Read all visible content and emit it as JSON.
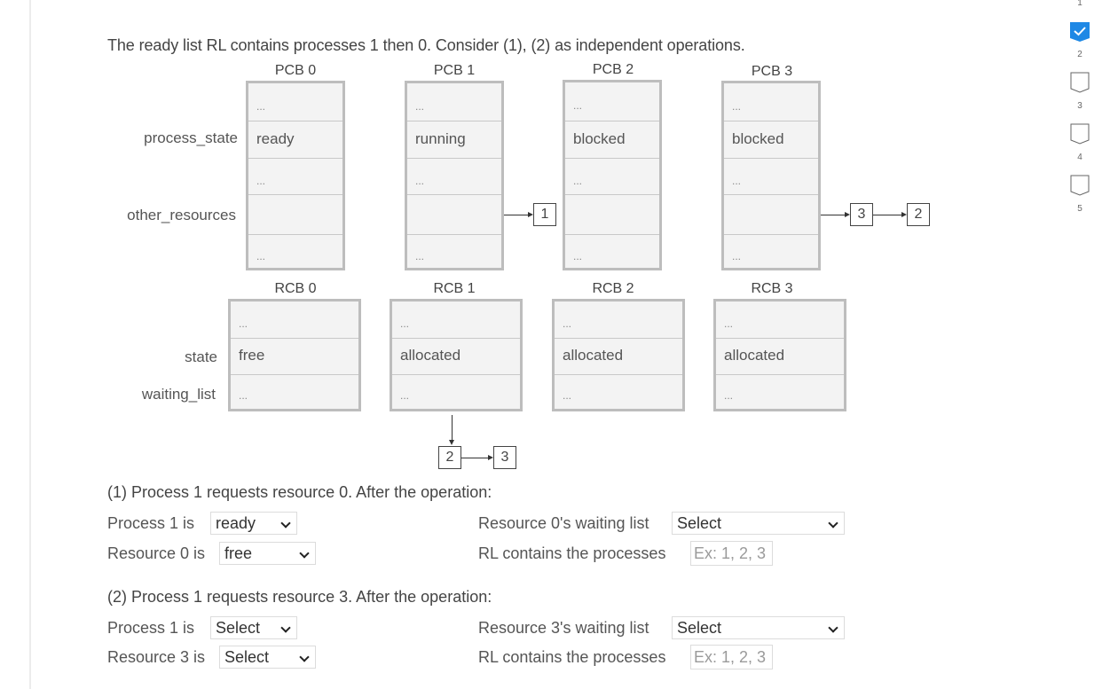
{
  "intro": "The ready list RL contains processes 1 then 0. Consider (1), (2) as independent operations.",
  "pcb_row_labels": {
    "process_state": "process_state",
    "other_resources": "other_resources"
  },
  "pcbs": [
    {
      "title": "PCB 0",
      "cells": [
        "...",
        "ready",
        "...",
        "",
        "..."
      ],
      "other_resources_list": []
    },
    {
      "title": "PCB 1",
      "cells": [
        "...",
        "running",
        "...",
        "",
        "..."
      ],
      "other_resources_list": [
        "1"
      ]
    },
    {
      "title": "PCB 2",
      "cells": [
        "...",
        "blocked",
        "...",
        "",
        "..."
      ],
      "other_resources_list": []
    },
    {
      "title": "PCB 3",
      "cells": [
        "...",
        "blocked",
        "...",
        "",
        "..."
      ],
      "other_resources_list": [
        "3",
        "2"
      ]
    }
  ],
  "rcb_row_labels": {
    "state": "state",
    "waiting_list": "waiting_list"
  },
  "rcbs": [
    {
      "title": "RCB 0",
      "cells": [
        "...",
        "free",
        "..."
      ],
      "waiting_list": []
    },
    {
      "title": "RCB 1",
      "cells": [
        "...",
        "allocated",
        "..."
      ],
      "waiting_list": [
        "2",
        "3"
      ]
    },
    {
      "title": "RCB 2",
      "cells": [
        "...",
        "allocated",
        "..."
      ],
      "waiting_list": []
    },
    {
      "title": "RCB 3",
      "cells": [
        "...",
        "allocated",
        "..."
      ],
      "waiting_list": []
    }
  ],
  "questions": [
    {
      "title": "(1) Process 1 requests resource 0. After the operation:",
      "process_label": "Process 1 is",
      "process_value": "ready",
      "resource_label": "Resource 0 is",
      "resource_value": "free",
      "waiting_label": "Resource 0's waiting list",
      "waiting_value": "Select",
      "rl_label": "RL contains the processes",
      "rl_placeholder": "Ex: 1, 2, 3",
      "rl_value": ""
    },
    {
      "title": "(2) Process 1 requests resource 3. After the operation:",
      "process_label": "Process 1 is",
      "process_value": "Select",
      "resource_label": "Resource 3 is",
      "resource_value": "Select",
      "waiting_label": "Resource 3's waiting list",
      "waiting_value": "Select",
      "rl_label": "RL contains the processes",
      "rl_placeholder": "Ex: 1, 2, 3",
      "rl_value": ""
    }
  ],
  "progress_nav": {
    "items": [
      {
        "number": "1",
        "status": "completed"
      },
      {
        "number": "2",
        "status": "incomplete"
      },
      {
        "number": "3",
        "status": "incomplete"
      },
      {
        "number": "4",
        "status": "incomplete"
      },
      {
        "number": "5",
        "status": "incomplete"
      }
    ],
    "accent_color": "#1e88e5"
  }
}
